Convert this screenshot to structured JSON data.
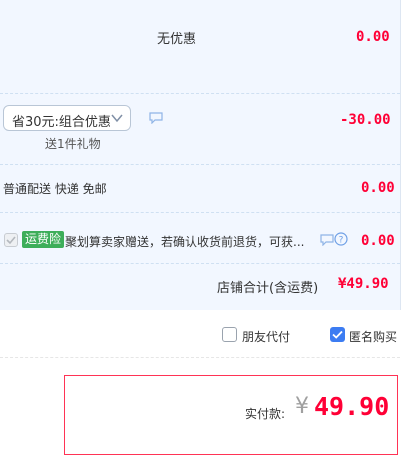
{
  "discount_row": {
    "label": "无优惠",
    "amount": "0.00"
  },
  "promo_row": {
    "select_value": "省30元:组合优惠",
    "gift_text": "送1件礼物",
    "amount": "-30.00"
  },
  "shipping_row": {
    "label": "普通配送 快递 免邮",
    "amount": "0.00"
  },
  "insurance_row": {
    "tag": "运费险",
    "text": "聚划算卖家赠送，若确认收货前退货，可获...",
    "amount": "0.00"
  },
  "store_total": {
    "label": "店铺合计(含运费)",
    "amount": "¥49.90"
  },
  "options": {
    "friend_pay": "朋友代付",
    "anonymous": "匿名购买"
  },
  "payment": {
    "label": "实付款:",
    "currency": "¥",
    "amount": "49.90"
  },
  "colors": {
    "accent": "#ff0036",
    "panel": "#f2f7ff",
    "insurance_tag": "#3dae5a",
    "checkbox_checked": "#3c7cf2"
  },
  "icons": [
    "message-icon",
    "chevron-down-icon",
    "help-icon",
    "check-icon"
  ]
}
